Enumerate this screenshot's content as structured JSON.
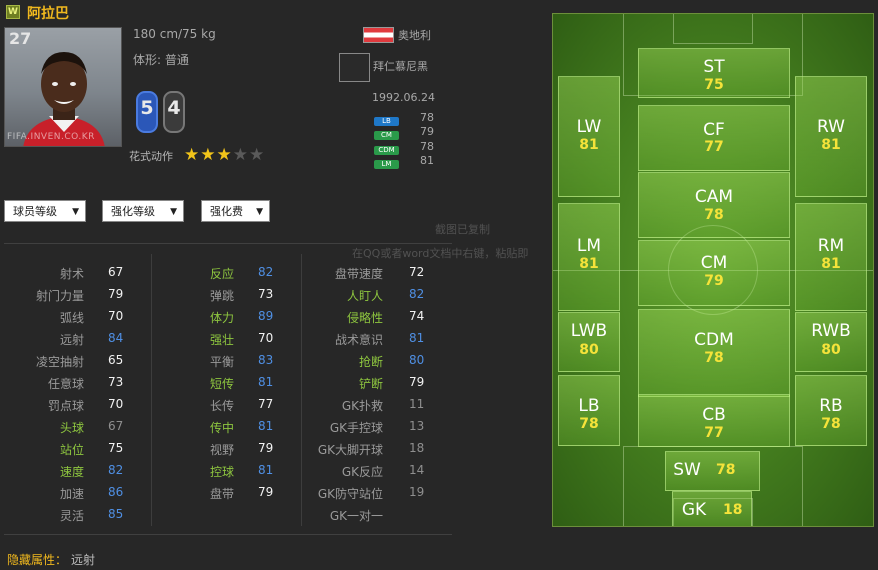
{
  "header": {
    "badge": "W",
    "player_name": "阿拉巴"
  },
  "card": {
    "overall": "27",
    "photo_watermark": "FIFA.INVEN.CO.KR",
    "height_weight": "180 cm/75 kg",
    "body_type": "体形: 普通",
    "right_foot": "5",
    "left_foot": "4",
    "skill_moves_label": "花式动作",
    "skill_moves_stars": 3,
    "skill_moves_max": 5,
    "nation": "奥地利",
    "club": "拜仁慕尼黑",
    "birth_date": "1992.06.24",
    "positions": [
      {
        "label": "LB",
        "value": "78",
        "color": "#1f78c8"
      },
      {
        "label": "CM",
        "value": "79",
        "color": "#2a9a4a"
      },
      {
        "label": "CDM",
        "value": "78",
        "color": "#2a9a4a"
      },
      {
        "label": "LM",
        "value": "81",
        "color": "#2a9a4a"
      }
    ]
  },
  "dropdowns": [
    {
      "label": "球员等级"
    },
    {
      "label": "强化等级"
    },
    {
      "label": "强化费"
    }
  ],
  "stats": {
    "col1": [
      {
        "label": "射术",
        "value": "67",
        "hl": false,
        "vc": "w"
      },
      {
        "label": "射门力量",
        "value": "79",
        "hl": false,
        "vc": "w"
      },
      {
        "label": "弧线",
        "value": "70",
        "hl": false,
        "vc": "w"
      },
      {
        "label": "远射",
        "value": "84",
        "hl": false,
        "vc": "b"
      },
      {
        "label": "凌空抽射",
        "value": "65",
        "hl": false,
        "vc": "w"
      },
      {
        "label": "任意球",
        "value": "73",
        "hl": false,
        "vc": "w"
      },
      {
        "label": "罚点球",
        "value": "70",
        "hl": false,
        "vc": "w"
      },
      {
        "label": "头球",
        "value": "67",
        "hl": true,
        "vc": "g"
      },
      {
        "label": "站位",
        "value": "75",
        "hl": true,
        "vc": "w"
      },
      {
        "label": "速度",
        "value": "82",
        "hl": true,
        "vc": "b"
      },
      {
        "label": "加速",
        "value": "86",
        "hl": false,
        "vc": "b"
      },
      {
        "label": "灵活",
        "value": "85",
        "hl": false,
        "vc": "b"
      }
    ],
    "col2": [
      {
        "label": "反应",
        "value": "82",
        "hl": true,
        "vc": "b"
      },
      {
        "label": "弹跳",
        "value": "73",
        "hl": false,
        "vc": "w"
      },
      {
        "label": "体力",
        "value": "89",
        "hl": true,
        "vc": "b"
      },
      {
        "label": "强壮",
        "value": "70",
        "hl": true,
        "vc": "w"
      },
      {
        "label": "平衡",
        "value": "83",
        "hl": false,
        "vc": "b"
      },
      {
        "label": "短传",
        "value": "81",
        "hl": true,
        "vc": "b"
      },
      {
        "label": "长传",
        "value": "77",
        "hl": false,
        "vc": "w"
      },
      {
        "label": "传中",
        "value": "81",
        "hl": true,
        "vc": "b"
      },
      {
        "label": "视野",
        "value": "79",
        "hl": false,
        "vc": "w"
      },
      {
        "label": "控球",
        "value": "81",
        "hl": true,
        "vc": "b"
      },
      {
        "label": "盘带",
        "value": "79",
        "hl": false,
        "vc": "w"
      }
    ],
    "col3": [
      {
        "label": "盘带速度",
        "value": "72",
        "hl": false,
        "vc": "w"
      },
      {
        "label": "人盯人",
        "value": "82",
        "hl": true,
        "vc": "b"
      },
      {
        "label": "侵略性",
        "value": "74",
        "hl": true,
        "vc": "w"
      },
      {
        "label": "战术意识",
        "value": "81",
        "hl": false,
        "vc": "b"
      },
      {
        "label": "抢断",
        "value": "80",
        "hl": true,
        "vc": "b"
      },
      {
        "label": "铲断",
        "value": "79",
        "hl": true,
        "vc": "w"
      },
      {
        "label": "GK扑救",
        "value": "11",
        "hl": false,
        "vc": "g"
      },
      {
        "label": "GK手控球",
        "value": "13",
        "hl": false,
        "vc": "g"
      },
      {
        "label": "GK大脚开球",
        "value": "18",
        "hl": false,
        "vc": "g"
      },
      {
        "label": "GK反应",
        "value": "14",
        "hl": false,
        "vc": "g"
      },
      {
        "label": "GK防守站位",
        "value": "19",
        "hl": false,
        "vc": "g"
      },
      {
        "label": "GK一对一",
        "value": "",
        "hl": false,
        "vc": "g"
      }
    ]
  },
  "hidden_traits": {
    "label": "隐藏属性：",
    "value": "远射"
  },
  "overlay_text": {
    "line1": "截图已复制",
    "line2": "在QQ或者word文档中右键，粘贴即"
  },
  "pitch": [
    {
      "pos": "ST",
      "value": "75"
    },
    {
      "pos": "LW",
      "value": "81"
    },
    {
      "pos": "CF",
      "value": "77"
    },
    {
      "pos": "RW",
      "value": "81"
    },
    {
      "pos": "CAM",
      "value": "78"
    },
    {
      "pos": "LM",
      "value": "81"
    },
    {
      "pos": "CM",
      "value": "79"
    },
    {
      "pos": "RM",
      "value": "81"
    },
    {
      "pos": "LWB",
      "value": "80"
    },
    {
      "pos": "CDM",
      "value": "78"
    },
    {
      "pos": "RWB",
      "value": "80"
    },
    {
      "pos": "LB",
      "value": "78"
    },
    {
      "pos": "CB",
      "value": "77"
    },
    {
      "pos": "RB",
      "value": "78"
    },
    {
      "pos": "SW",
      "value": "78"
    },
    {
      "pos": "GK",
      "value": "18"
    }
  ]
}
